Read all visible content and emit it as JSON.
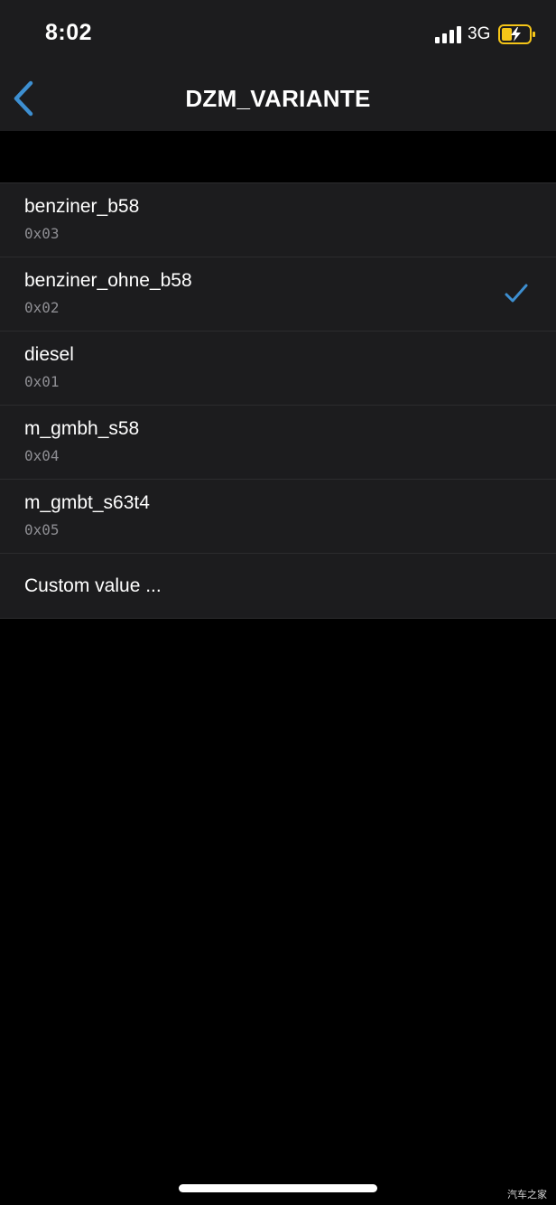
{
  "status_bar": {
    "time": "8:02",
    "network": "3G",
    "signal_icon": "cellular-signal-icon",
    "battery_icon": "battery-charging-icon",
    "battery_color": "#f5c518"
  },
  "nav": {
    "title": "DZM_VARIANTE",
    "back_icon": "chevron-left-icon",
    "accent_color": "#3d8fd1"
  },
  "options": [
    {
      "label": "benziner_b58",
      "value": "0x03",
      "selected": false
    },
    {
      "label": "benziner_ohne_b58",
      "value": "0x02",
      "selected": true
    },
    {
      "label": "diesel",
      "value": "0x01",
      "selected": false
    },
    {
      "label": "m_gmbh_s58",
      "value": "0x04",
      "selected": false
    },
    {
      "label": "m_gmbt_s63t4",
      "value": "0x05",
      "selected": false
    }
  ],
  "custom_value_label": "Custom value ...",
  "watermark": "汽车之家"
}
